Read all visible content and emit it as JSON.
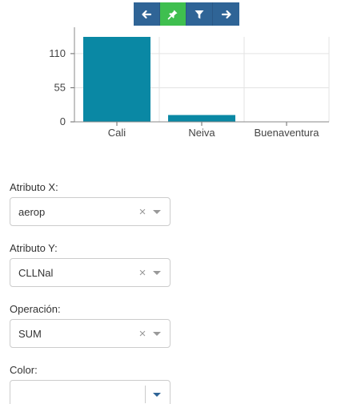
{
  "toolbar": {
    "buttons": [
      {
        "icon": "arrow-left-icon",
        "active": false
      },
      {
        "icon": "pin-icon",
        "active": true
      },
      {
        "icon": "filter-icon",
        "active": false
      },
      {
        "icon": "arrow-right-icon",
        "active": false
      }
    ],
    "colors": {
      "base": "#2f6496",
      "active": "#3fbf4f"
    }
  },
  "chart_data": {
    "type": "bar",
    "categories": [
      "Cali",
      "Neiva",
      "Buenaventura"
    ],
    "values": [
      137,
      11,
      0
    ],
    "yticks": [
      0,
      55,
      110
    ],
    "ylim": [
      0,
      137
    ],
    "grid": true,
    "bar_color": "#0a88a4"
  },
  "form": {
    "atributo_x": {
      "label": "Atributo X:",
      "value": "aerop"
    },
    "atributo_y": {
      "label": "Atributo Y:",
      "value": "CLLNal"
    },
    "operacion": {
      "label": "Operación:",
      "value": "SUM"
    },
    "color": {
      "label": "Color:",
      "value": ""
    },
    "clear_symbol": "×"
  }
}
